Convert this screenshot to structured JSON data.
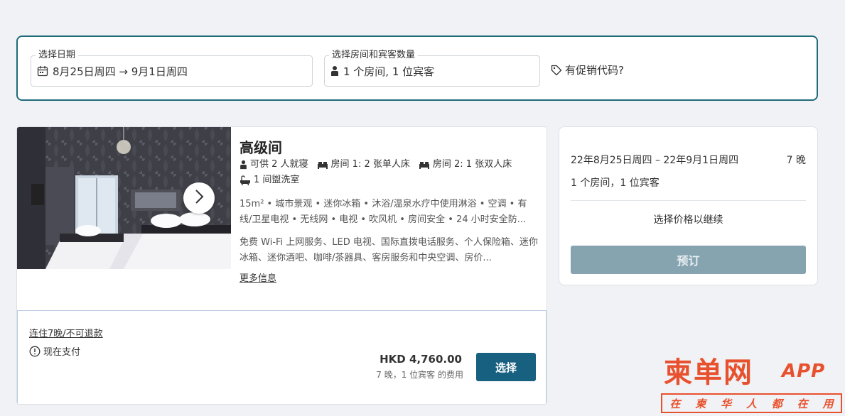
{
  "search": {
    "date_legend": "选择日期",
    "date_value": "8月25日周四 → 9月1日周四",
    "rooms_legend": "选择房间和宾客数量",
    "rooms_value": "1 个房间, 1 位宾客",
    "promo_label": "有促销代码?"
  },
  "room": {
    "title": "高级间",
    "features": [
      {
        "icon": "person-icon",
        "text": "可供 2 人就寝"
      },
      {
        "icon": "bed-icon",
        "text": "房间 1: 2 张单人床"
      },
      {
        "icon": "bed-icon",
        "text": "房间 2: 1 张双人床"
      },
      {
        "icon": "bathtub-icon",
        "text": "1 间盥洗室"
      }
    ],
    "amenities": "15m² • 城市景观 • 迷你冰箱 • 沐浴/温泉水疗中使用淋浴 • 空调 • 有线/卫星电视 • 无线网 • 电视 • 吹风机 • 房间安全 • 24 小时安全防...",
    "services": "免费 Wi-Fi 上网服务、LED 电视、国际直拨电话服务、个人保险箱、迷你冰箱、迷你酒吧、咖啡/茶器具、客房服务和中央空调、房价...",
    "more_info": "更多信息"
  },
  "rate": {
    "name": "连住7晚/不可退款",
    "pay_now": "现在支付",
    "price": "HKD 4,760.00",
    "price_note": "7 晚，1 位宾客 的费用",
    "select_label": "选择"
  },
  "summary": {
    "dates": "22年8月25日周四 – 22年9月1日周四",
    "nights": "7 晚",
    "guests": "1 个房间，1 位宾客",
    "prompt": "选择价格以继续",
    "book_label": "预订"
  },
  "watermark": {
    "main": "柬单网",
    "app": "APP",
    "sub": [
      "在",
      "柬",
      "华",
      "人",
      "都",
      "在",
      "用"
    ]
  },
  "colors": {
    "accent": "#1f6b79",
    "select_button": "#17607f",
    "book_button_disabled": "#85a4b0",
    "watermark": "#e8512e"
  }
}
